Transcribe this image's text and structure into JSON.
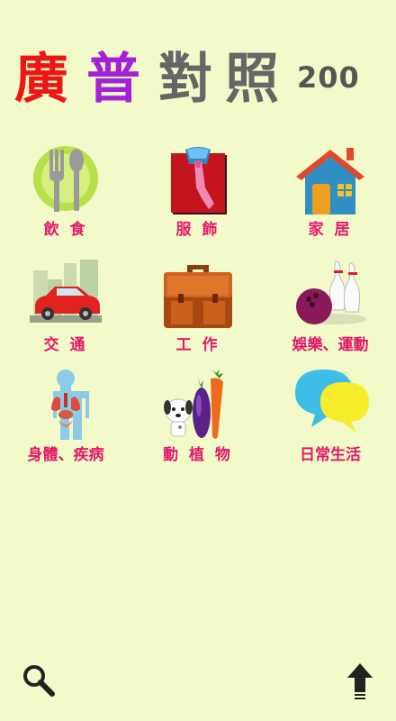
{
  "title": {
    "c1": "廣",
    "c1_color": "#ee1515",
    "c2": "普",
    "c2_color": "#a620d8",
    "c3": "對",
    "c3_color": "#666666",
    "c4": "照",
    "c4_color": "#666666",
    "num": "200",
    "num_color": "#555555"
  },
  "categories": [
    {
      "label": "飲 食",
      "icon": "plate-fork-spoon-icon"
    },
    {
      "label": "服 飾",
      "icon": "shirt-tie-icon"
    },
    {
      "label": "家 居",
      "icon": "house-icon"
    },
    {
      "label": "交 通",
      "icon": "car-icon"
    },
    {
      "label": "工 作",
      "icon": "briefcase-icon"
    },
    {
      "label": "娛樂、運動",
      "icon": "bowling-icon"
    },
    {
      "label": "身體、疾病",
      "icon": "body-organs-icon"
    },
    {
      "label": "動 植 物",
      "icon": "dog-vegetables-icon"
    },
    {
      "label": "日常生活",
      "icon": "speech-bubbles-icon"
    }
  ],
  "bottom": {
    "search_icon": "search-icon",
    "up_icon": "up-arrow-icon"
  },
  "colors": {
    "background": "#f1fac8",
    "label": "#e5176b"
  }
}
